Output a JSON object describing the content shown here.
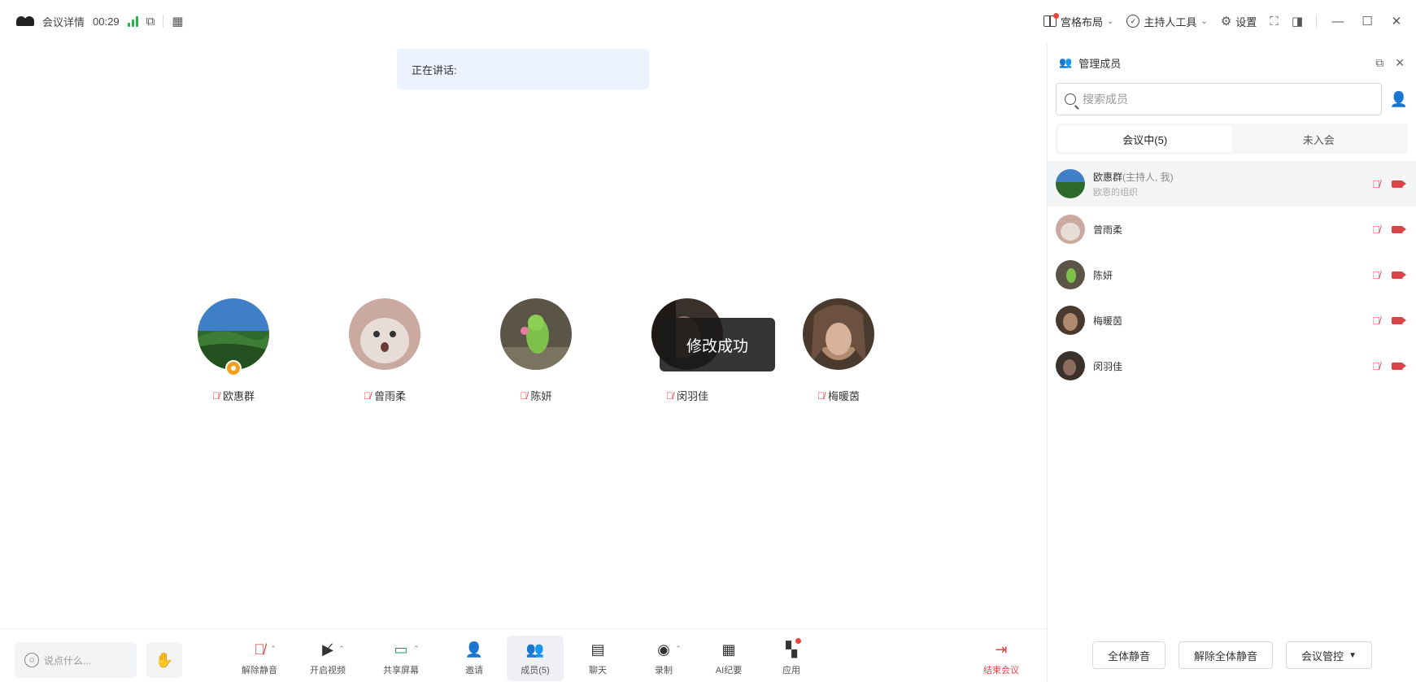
{
  "titlebar": {
    "meeting_details": "会议详情",
    "timer": "00:29",
    "layout": "宫格布局",
    "host_tools": "主持人工具",
    "settings": "设置"
  },
  "stage": {
    "speaking_label": "正在讲话:",
    "toast": "修改成功",
    "participants": [
      {
        "name": "欧惠群",
        "host": true
      },
      {
        "name": "曾雨柔",
        "host": false
      },
      {
        "name": "陈妍",
        "host": false
      },
      {
        "name": "闵羽佳",
        "host": false
      },
      {
        "name": "梅暖茵",
        "host": false
      }
    ]
  },
  "toolbar": {
    "chat_placeholder": "说点什么...",
    "unmute": "解除静音",
    "start_video": "开启视频",
    "share_screen": "共享屏幕",
    "invite": "邀请",
    "members": "成员(5)",
    "chat": "聊天",
    "record": "录制",
    "ai_minutes": "AI纪要",
    "apps": "应用",
    "end_meeting": "结束会议"
  },
  "panel": {
    "title": "管理成员",
    "search_placeholder": "搜索成员",
    "tab_in_meeting": "会议中(5)",
    "tab_not_joined": "未入会",
    "members": [
      {
        "name": "欧惠群",
        "role": "(主持人, 我)",
        "sub": "欧恩的组织"
      },
      {
        "name": "曾雨柔",
        "role": "",
        "sub": ""
      },
      {
        "name": "陈妍",
        "role": "",
        "sub": ""
      },
      {
        "name": "梅暖茵",
        "role": "",
        "sub": ""
      },
      {
        "name": "闵羽佳",
        "role": "",
        "sub": ""
      }
    ],
    "mute_all": "全体静音",
    "unmute_all": "解除全体静音",
    "meeting_control": "会议管控"
  },
  "colors": {
    "muted_red": "#d9434a",
    "host_badge": "#f0a020",
    "signal_green": "#2bb34a",
    "speaking_bg": "#edf3fe"
  }
}
